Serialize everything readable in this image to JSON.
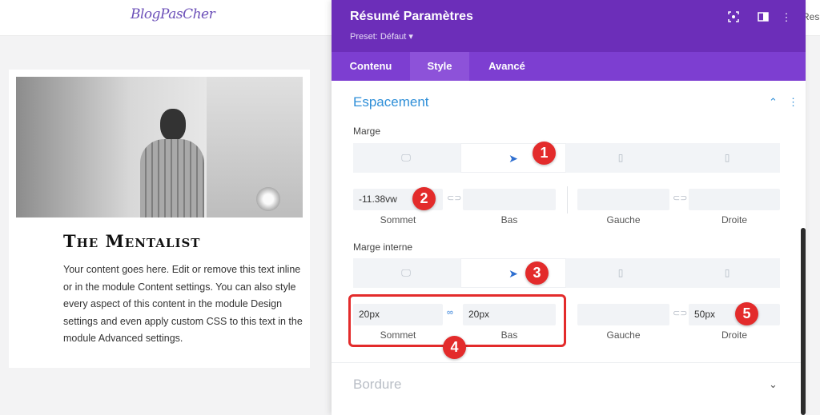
{
  "page": {
    "logo": "BlogPasCher",
    "top_right_text": "Res"
  },
  "card": {
    "title": "The Mentalist",
    "body": "Your content goes here. Edit or remove this text inline or in the module Content settings. You can also style every aspect of this content in the module Design settings and even apply custom CSS to this text in the module Advanced settings."
  },
  "panel": {
    "title": "Résumé Paramètres",
    "preset": "Preset: Défaut",
    "tabs": [
      "Contenu",
      "Style",
      "Avancé"
    ],
    "active_tab": "Style",
    "section": {
      "title": "Espacement",
      "margin": {
        "label": "Marge",
        "top_value": "-11.38vw",
        "bottom_value": "",
        "left_value": "",
        "right_value": "",
        "labels": [
          "Sommet",
          "Bas",
          "Gauche",
          "Droite"
        ]
      },
      "padding": {
        "label": "Marge interne",
        "top_value": "20px",
        "bottom_value": "20px",
        "left_value": "",
        "right_value": "50px",
        "labels": [
          "Sommet",
          "Bas",
          "Gauche",
          "Droite"
        ]
      }
    },
    "next_section": "Bordure"
  },
  "badges": [
    "1",
    "2",
    "3",
    "4",
    "5"
  ],
  "colors": {
    "header": "#6c2eb9",
    "tabs": "#7d3ed1",
    "accent": "#2f8fd8",
    "badge": "#e32b2b"
  },
  "icons": [
    "screenshot-icon",
    "split-view-icon",
    "more-vertical-icon",
    "desktop-icon",
    "cursor-icon",
    "tablet-icon",
    "phone-icon",
    "link-icon",
    "chevron-up-icon",
    "chevron-down-icon"
  ]
}
